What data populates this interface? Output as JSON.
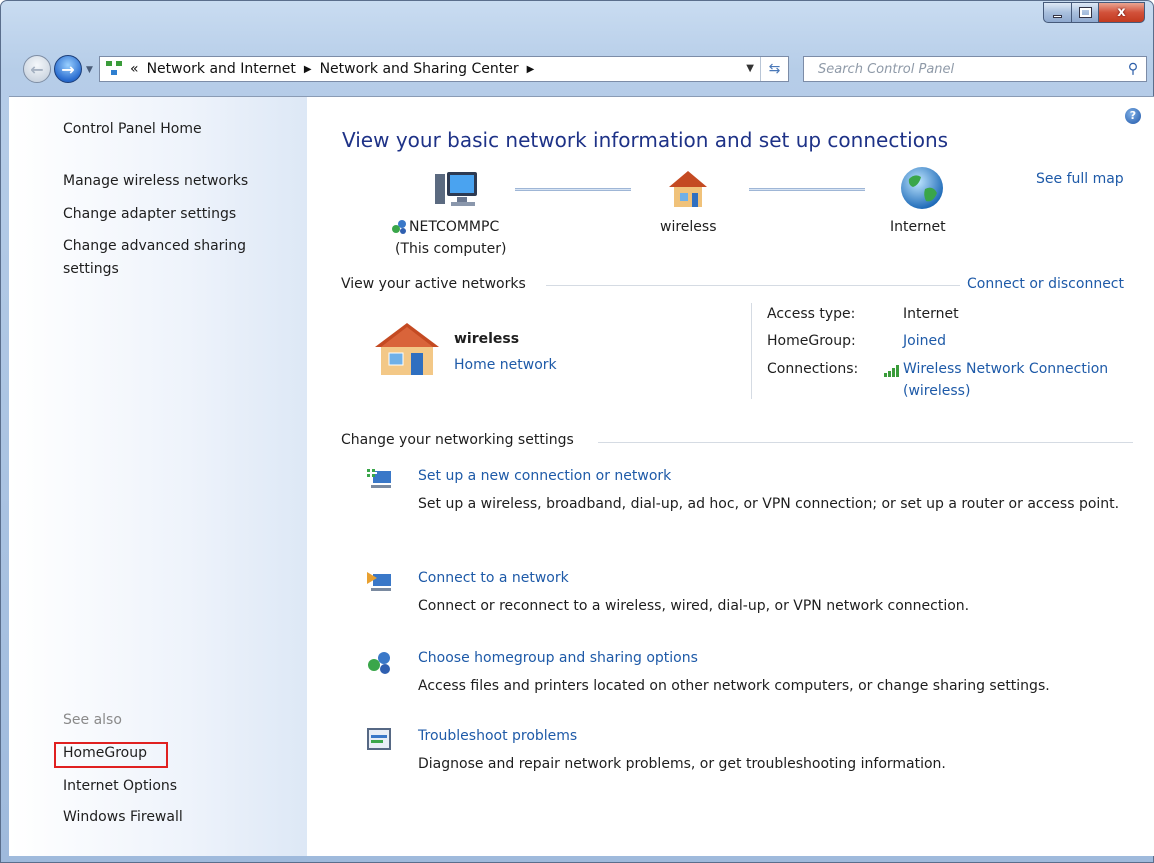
{
  "window": {
    "controls": {
      "close_glyph": "x"
    }
  },
  "nav": {
    "back_glyph": "←",
    "forward_glyph": "→",
    "breadcrumb_overflow": "«",
    "breadcrumbs": [
      "Network and Internet",
      "Network and Sharing Center"
    ],
    "search_placeholder": "Search Control Panel"
  },
  "sidebar": {
    "home": "Control Panel Home",
    "tasks": [
      "Manage wireless networks",
      "Change adapter settings",
      "Change advanced sharing",
      "settings"
    ],
    "see_also_heading": "See also",
    "see_also": [
      "HomeGroup",
      "Internet Options",
      "Windows Firewall"
    ]
  },
  "main": {
    "heading": "View your basic network information and set up connections",
    "see_full_map": "See full map",
    "map": {
      "computer_name": "NETCOMMPC",
      "computer_sub": "(This computer)",
      "network_name": "wireless",
      "internet": "Internet"
    },
    "active_networks": {
      "title": "View your active networks",
      "connect_disconnect": "Connect or disconnect",
      "network_name": "wireless",
      "network_type": "Home network",
      "access_type_label": "Access type:",
      "access_type_value": "Internet",
      "homegroup_label": "HomeGroup:",
      "homegroup_value": "Joined",
      "connections_label": "Connections:",
      "connection_line1": "Wireless Network Connection",
      "connection_line2": "(wireless)"
    },
    "settings": {
      "title": "Change your networking settings",
      "tasks": [
        {
          "title": "Set up a new connection or network",
          "desc": "Set up a wireless, broadband, dial-up, ad hoc, or VPN connection; or set up a router or access point."
        },
        {
          "title": "Connect to a network",
          "desc": "Connect or reconnect to a wireless, wired, dial-up, or VPN network connection."
        },
        {
          "title": "Choose homegroup and sharing options",
          "desc": "Access files and printers located on other network computers, or change sharing settings."
        },
        {
          "title": "Troubleshoot problems",
          "desc": "Diagnose and repair network problems, or get troubleshooting information."
        }
      ]
    }
  },
  "colors": {
    "link": "#1e5aa8",
    "heading": "#1e3287",
    "highlight_box": "#e02020"
  }
}
